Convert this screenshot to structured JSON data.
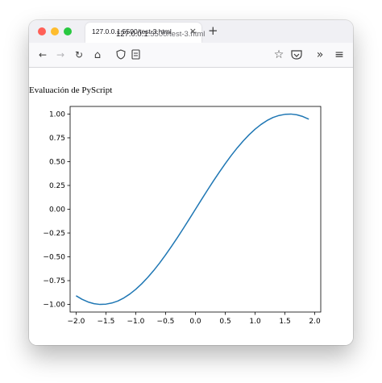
{
  "browser": {
    "tab_title": "127.0.0.1:5500/test-3.html",
    "tab_close": "×",
    "new_tab": "+",
    "url_host": "127.0.0.1",
    "url_path": ":5500/test-3.html",
    "nav": {
      "back": "←",
      "forward": "→",
      "reload": "↻",
      "home": "⌂",
      "bookmark": "☆",
      "overflow": "»",
      "menu": "≡"
    }
  },
  "page": {
    "heading": "Evaluación de PyScript"
  },
  "chart_data": {
    "type": "line",
    "title": "",
    "xlabel": "",
    "ylabel": "",
    "xlim": [
      -2.1,
      2.1
    ],
    "ylim": [
      -1.08,
      1.08
    ],
    "x_ticks": [
      -2.0,
      -1.5,
      -1.0,
      -0.5,
      0.0,
      0.5,
      1.0,
      1.5,
      2.0
    ],
    "x_tick_labels": [
      "−2.0",
      "−1.5",
      "−1.0",
      "−0.5",
      "0.0",
      "0.5",
      "1.0",
      "1.5",
      "2.0"
    ],
    "y_ticks": [
      1.0,
      0.75,
      0.5,
      0.25,
      0.0,
      -0.25,
      -0.5,
      -0.75,
      -1.0
    ],
    "y_tick_labels": [
      "1.00",
      "0.75",
      "0.50",
      "0.25",
      "0.00",
      "−0.25",
      "−0.50",
      "−0.75",
      "−1.00"
    ],
    "grid": false,
    "series": [
      {
        "color": "#1f77b4",
        "x": [
          -2.0,
          -1.9,
          -1.8,
          -1.7,
          -1.6,
          -1.5,
          -1.4,
          -1.3,
          -1.2,
          -1.1,
          -1.0,
          -0.9,
          -0.8,
          -0.7,
          -0.6,
          -0.5,
          -0.4,
          -0.3,
          -0.2,
          -0.1,
          0.0,
          0.1,
          0.2,
          0.3,
          0.4,
          0.5,
          0.6,
          0.7,
          0.8,
          0.9,
          1.0,
          1.1,
          1.2,
          1.3,
          1.4,
          1.5,
          1.6,
          1.7,
          1.8,
          1.9
        ],
        "y": [
          -0.909,
          -0.946,
          -0.974,
          -0.992,
          -1.0,
          -0.997,
          -0.985,
          -0.964,
          -0.932,
          -0.891,
          -0.841,
          -0.783,
          -0.717,
          -0.644,
          -0.565,
          -0.479,
          -0.389,
          -0.296,
          -0.199,
          -0.1,
          0.0,
          0.1,
          0.199,
          0.296,
          0.389,
          0.479,
          0.565,
          0.644,
          0.717,
          0.783,
          0.841,
          0.891,
          0.932,
          0.964,
          0.985,
          0.997,
          1.0,
          0.992,
          0.974,
          0.946
        ]
      }
    ]
  }
}
